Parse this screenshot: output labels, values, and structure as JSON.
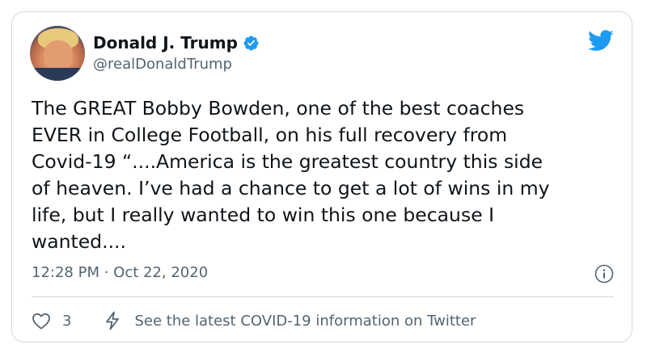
{
  "author": {
    "name": "Donald J. Trump",
    "handle": "@realDonaldTrump",
    "verified": true,
    "avatar_icon": "profile-photo"
  },
  "tweet": {
    "text": "The GREAT Bobby Bowden, one of the best coaches\nEVER in College Football, on his full recovery from\nCovid-19 “....America is the greatest country this side\nof heaven. I’ve had a chance to get a lot of wins in my\nlife, but I really wanted to win this one because I\nwanted....",
    "timestamp": "12:28 PM · Oct 22, 2020"
  },
  "actions": {
    "like_count": "3",
    "covid_link_text": "See the latest COVID-19 information on Twitter"
  },
  "colors": {
    "text_primary": "#0f1419",
    "text_secondary": "#536471",
    "twitter_blue": "#1d9bf0",
    "border": "#cfd9de"
  },
  "icons": {
    "brand": "twitter-bird-icon",
    "verified": "verified-badge-icon",
    "info": "info-icon",
    "like": "heart-icon",
    "covid": "lightning-icon"
  }
}
